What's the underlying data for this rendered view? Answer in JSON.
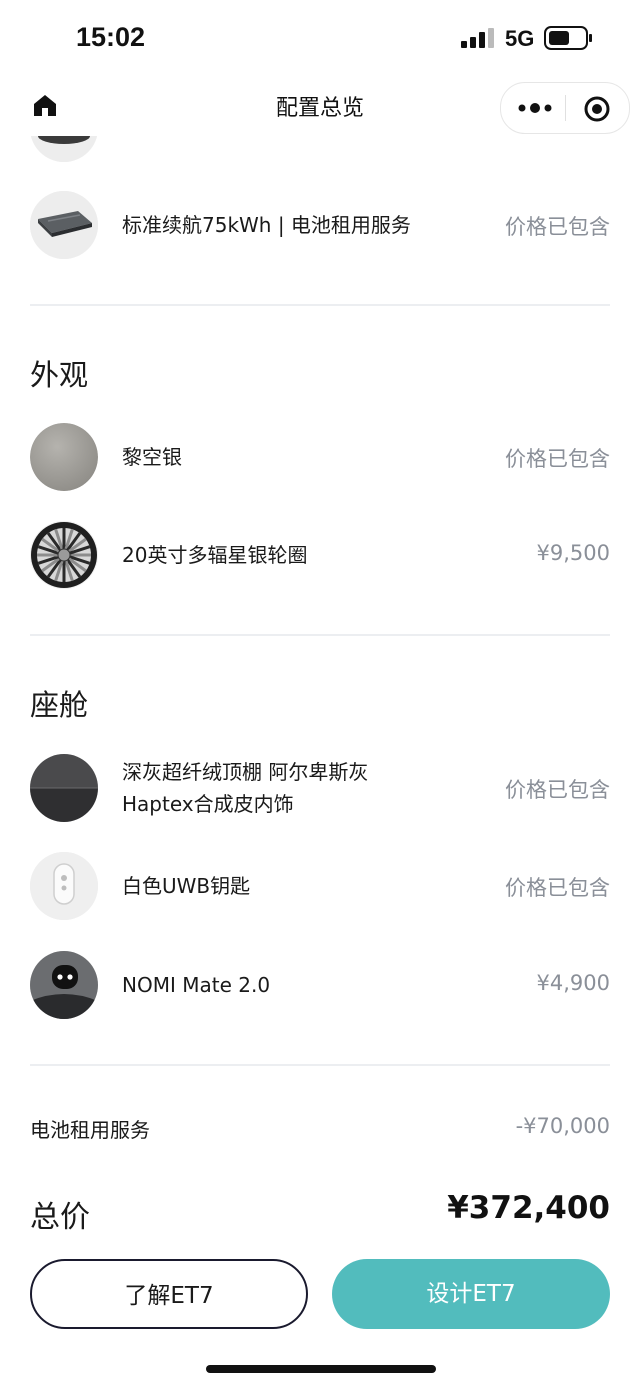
{
  "status_bar": {
    "time": "15:02",
    "network": "5G"
  },
  "nav": {
    "title": "配置总览"
  },
  "colors": {
    "accent": "#52bcbd",
    "price_gray": "#8a8f98",
    "text": "#1a1a1a"
  },
  "battery_row": {
    "label": "标准续航75kWh | 电池租用服务",
    "price": "价格已包含"
  },
  "exterior": {
    "title": "外观",
    "items": [
      {
        "label": "黎空银",
        "price": "价格已包含",
        "icon": "silver-paint-swatch"
      },
      {
        "label": "20英寸多辐星银轮圈",
        "price": "¥9,500",
        "icon": "wheel-rim"
      }
    ]
  },
  "cabin": {
    "title": "座舱",
    "items": [
      {
        "label_line1": "深灰超纤绒顶棚 阿尔卑斯灰",
        "label_line2": "Haptex合成皮内饰",
        "price": "价格已包含",
        "icon": "interior-swatch"
      },
      {
        "label": "白色UWB钥匙",
        "price": "价格已包含",
        "icon": "uwb-key"
      },
      {
        "label": "NOMI Mate 2.0",
        "price": "¥4,900",
        "icon": "nomi-robot"
      }
    ]
  },
  "battery_service": {
    "label": "电池租用服务",
    "value": "-¥70,000"
  },
  "total": {
    "label": "总价",
    "value": "¥372,400"
  },
  "buttons": {
    "learn": "了解ET7",
    "design": "设计ET7"
  }
}
